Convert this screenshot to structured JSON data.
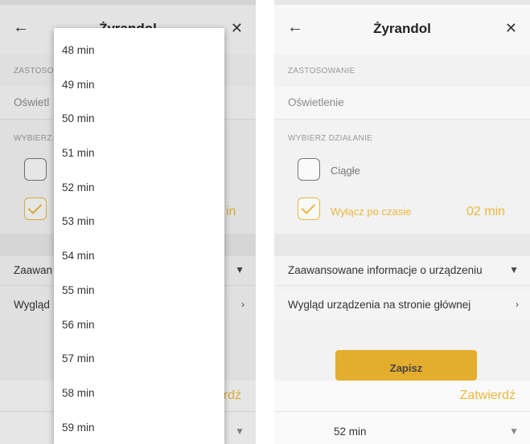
{
  "left_screen": {
    "header": {
      "title": "Żyrandol",
      "back_icon": "arrow-left-icon",
      "close_icon": "close-icon"
    },
    "section_usage_label": "ZASTOSO",
    "usage_value": "Oświetl",
    "section_action_label": "WYBIERZ",
    "selected_minutes_partial": "in",
    "menu": [
      {
        "label": "Zaawan",
        "icon": "caret-down-icon"
      },
      {
        "label": "Wygląd",
        "icon": "chevron-right-icon"
      }
    ],
    "bottom": {
      "confirm_label": "rdź"
    },
    "dropdown": {
      "options": [
        "48 min",
        "49 min",
        "50 min",
        "51 min",
        "52 min",
        "53 min",
        "54 min",
        "55 min",
        "56 min",
        "57 min",
        "58 min",
        "59 min"
      ]
    }
  },
  "right_screen": {
    "header": {
      "title": "Żyrandol",
      "back_icon": "arrow-left-icon",
      "close_icon": "close-icon"
    },
    "section_usage_label": "ZASTOSOWANIE",
    "usage_value": "Oświetlenie",
    "section_action_label": "WYBIERZ DZIAŁANIE",
    "options": [
      {
        "label": "Ciągłe",
        "checked": false
      },
      {
        "label": "Wyłącz po czasie",
        "checked": true
      }
    ],
    "selected_minutes": "02 min",
    "menu": [
      {
        "label": "Zaawansowane informacje o urządzeniu",
        "icon": "caret-down-icon"
      },
      {
        "label": "Wygląd urządzenia na stronie głównej",
        "icon": "chevron-right-icon"
      }
    ],
    "save_label": "Zapisz",
    "bottom": {
      "confirm_label": "Zatwierdź",
      "selected_value": "52 min"
    }
  },
  "colors": {
    "accent": "#e9b83f",
    "button": "#e4ad2d"
  }
}
